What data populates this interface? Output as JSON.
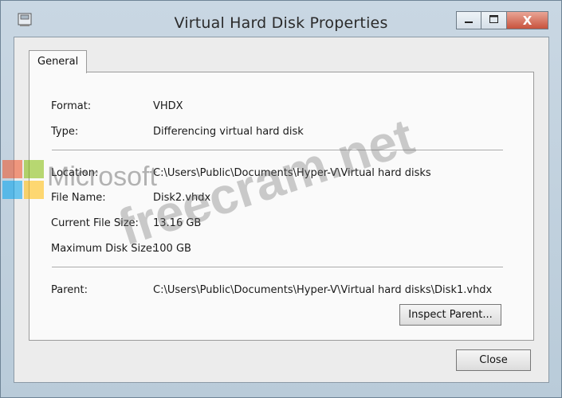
{
  "window": {
    "title": "Virtual Hard Disk Properties",
    "minimize_icon": "minimize-icon",
    "maximize_icon": "maximize-icon",
    "close_icon": "close-icon",
    "close_glyph": "X"
  },
  "tabs": [
    {
      "label": "General",
      "selected": true
    }
  ],
  "general": {
    "format": {
      "label": "Format:",
      "value": "VHDX"
    },
    "type": {
      "label": "Type:",
      "value": "Differencing virtual hard disk"
    },
    "location": {
      "label": "Location:",
      "value": "C:\\Users\\Public\\Documents\\Hyper-V\\Virtual hard disks"
    },
    "file_name": {
      "label": "File Name:",
      "value": "Disk2.vhdx"
    },
    "current_file_size": {
      "label": "Current File Size:",
      "value": "13.16 GB"
    },
    "maximum_disk_size": {
      "label": "Maximum Disk Size:",
      "value": "100 GB"
    },
    "parent": {
      "label": "Parent:",
      "value": "C:\\Users\\Public\\Documents\\Hyper-V\\Virtual hard disks\\Disk1.vhdx"
    },
    "inspect_parent_label": "Inspect Parent..."
  },
  "footer": {
    "close_label": "Close"
  },
  "watermarks": {
    "logo_text": "Microsoft",
    "site_text": "freecram.net",
    "logo_colors": [
      "#f25022",
      "#7fba00",
      "#00a4ef",
      "#ffb900"
    ]
  }
}
